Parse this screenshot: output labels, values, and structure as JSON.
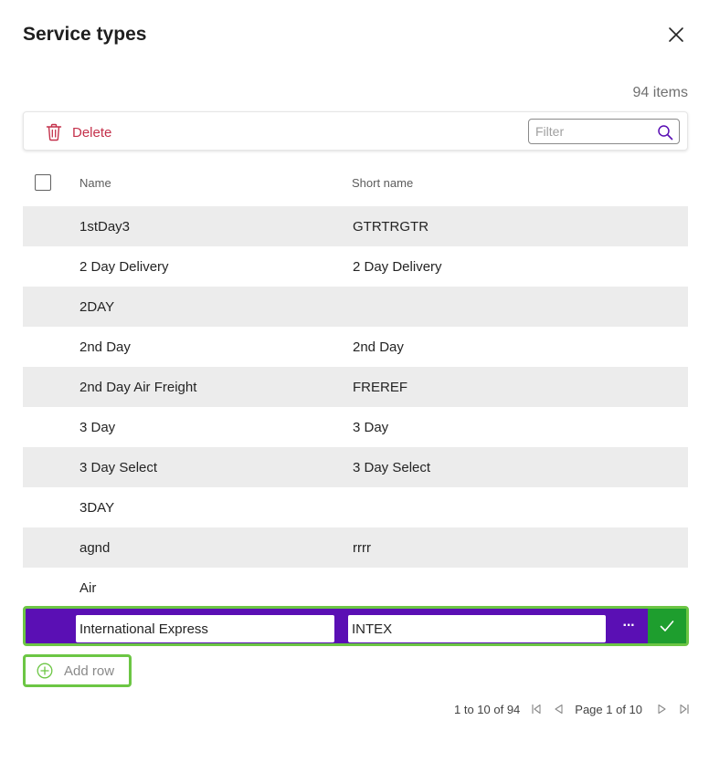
{
  "dialog": {
    "title": "Service types",
    "item_count": "94 items"
  },
  "toolbar": {
    "delete_label": "Delete",
    "filter_placeholder": "Filter"
  },
  "columns": {
    "name": "Name",
    "short_name": "Short name"
  },
  "rows": [
    {
      "name": "1stDay3",
      "short": "GTRTRGTR"
    },
    {
      "name": "2 Day Delivery",
      "short": "2 Day Delivery"
    },
    {
      "name": "2DAY",
      "short": ""
    },
    {
      "name": "2nd Day",
      "short": "2nd Day"
    },
    {
      "name": "2nd Day Air Freight",
      "short": "FREREF"
    },
    {
      "name": "3 Day",
      "short": "3 Day"
    },
    {
      "name": "3 Day Select",
      "short": "3 Day Select"
    },
    {
      "name": "3DAY",
      "short": ""
    },
    {
      "name": "agnd",
      "short": "rrrr"
    },
    {
      "name": "Air",
      "short": ""
    }
  ],
  "edit_row": {
    "name_value": "International Express",
    "short_value": "INTEX",
    "more_label": "···"
  },
  "add_row": {
    "label": "Add row"
  },
  "pagination": {
    "range": "1 to 10 of 94",
    "page_text": "Page 1 of 10"
  },
  "colors": {
    "accent_purple": "#5a0fb4",
    "highlight_green": "#6cc644",
    "confirm_green": "#1e9e2e",
    "delete_red": "#c4314b"
  },
  "icons": {
    "close": "close-icon",
    "delete": "trash-icon",
    "search": "search-icon",
    "confirm": "checkmark-icon",
    "add": "plus-circle-icon"
  }
}
